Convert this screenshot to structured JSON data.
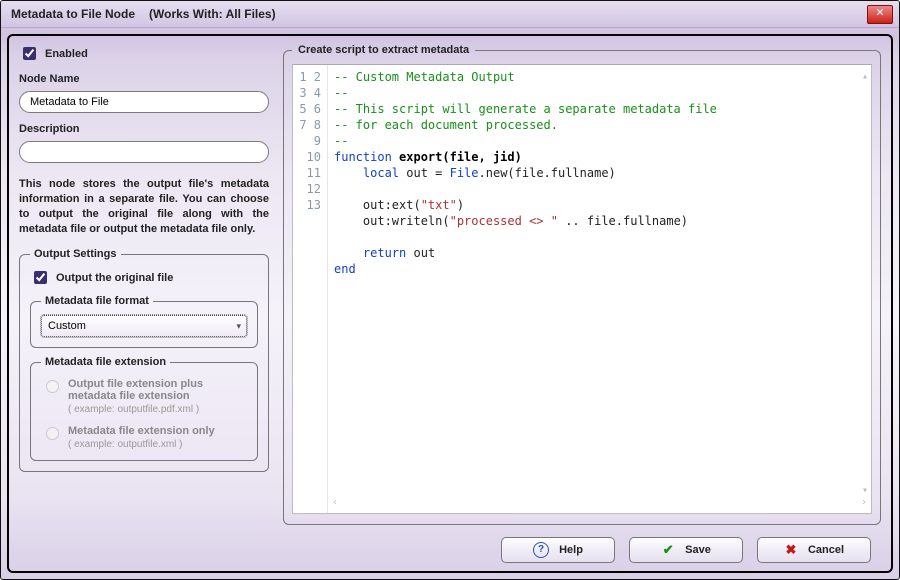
{
  "window": {
    "title": "Metadata to File Node",
    "works_with": "(Works With: All Files)"
  },
  "enabled": {
    "label": "Enabled",
    "checked": true
  },
  "node_name": {
    "label": "Node Name",
    "value": "Metadata to File"
  },
  "description": {
    "label": "Description",
    "value": ""
  },
  "help_text": "This node stores the output file's metadata information in a separate file. You can choose to output the original file along with the metadata file or output the metadata file only.",
  "output_settings": {
    "legend": "Output Settings",
    "output_original": {
      "label": "Output the original file",
      "checked": true
    },
    "file_format": {
      "legend": "Metadata file format",
      "value": "Custom"
    },
    "file_ext": {
      "legend": "Metadata file extension",
      "opts": [
        {
          "label": "Output file extension plus metadata file extension",
          "example": "( example: outputfile.pdf.xml )"
        },
        {
          "label": "Metadata file extension only",
          "example": "( example: outputfile.xml )"
        }
      ]
    }
  },
  "editor": {
    "legend": "Create script to extract metadata",
    "gutter_lines": "1\n2\n3\n4\n5\n6\n7\n8\n9\n10\n11\n12\n13",
    "code_tokens": {
      "l1": "-- Custom Metadata Output",
      "l2": "--",
      "l3": "-- This script will generate a separate metadata file",
      "l4": "-- for each document processed.",
      "l5": "--",
      "l6_kw1": "function",
      "l6_name": " export(file, jid)",
      "l7_kw": "local",
      "l7_mid": " out = ",
      "l7_type": "File",
      "l7_tail": ".new(file.fullname)",
      "l9_pre": "    out:ext(",
      "l9_str": "\"txt\"",
      "l9_post": ")",
      "l10_pre": "    out:writeln(",
      "l10_str": "\"processed <> \"",
      "l10_post": " .. file.fullname)",
      "l12_kw": "return",
      "l12_post": " out",
      "l13": "end"
    }
  },
  "buttons": {
    "help": "Help",
    "save": "Save",
    "cancel": "Cancel"
  }
}
